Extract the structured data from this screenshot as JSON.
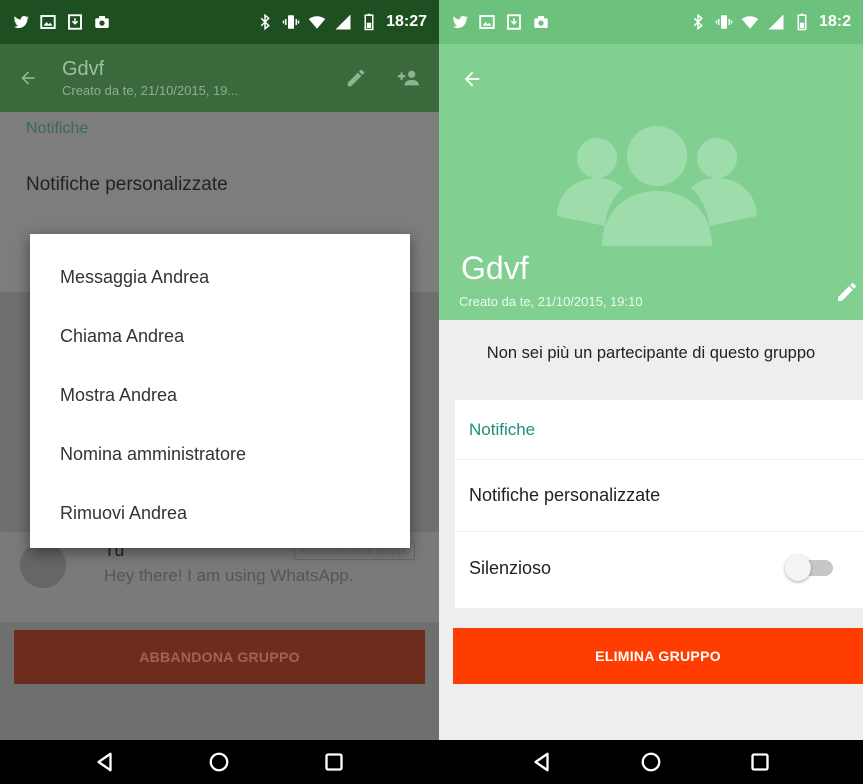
{
  "left": {
    "status": {
      "time": "18:27"
    },
    "appbar": {
      "title": "Gdvf",
      "subtitle": "Creato da te, 21/10/2015, 19..."
    },
    "section_title": "Notifiche",
    "row_custom_notifications": "Notifiche personalizzate",
    "dialog": {
      "items": [
        "Messaggia Andrea",
        "Chiama Andrea",
        "Mostra Andrea",
        "Nomina amministratore",
        "Rimuovi Andrea"
      ]
    },
    "member": {
      "name": "Tu",
      "status": "Hey there! I am using WhatsApp.",
      "badge": "Amministratore gruppo"
    },
    "leave_button": "ABBANDONA GRUPPO"
  },
  "right": {
    "status": {
      "time": "18:2"
    },
    "hero": {
      "title": "Gdvf",
      "subtitle": "Creato da te, 21/10/2015, 19:10"
    },
    "notice": "Non sei più un partecipante di questo gruppo",
    "card": {
      "header": "Notifiche",
      "row_custom": "Notifiche personalizzate",
      "row_silent": "Silenzioso",
      "silent_enabled": false
    },
    "delete_button": "ELIMINA GRUPPO"
  },
  "colors": {
    "whatsapp_green": "#81cf91",
    "accent_teal": "#1f8f7a",
    "danger": "#ff3d00"
  }
}
